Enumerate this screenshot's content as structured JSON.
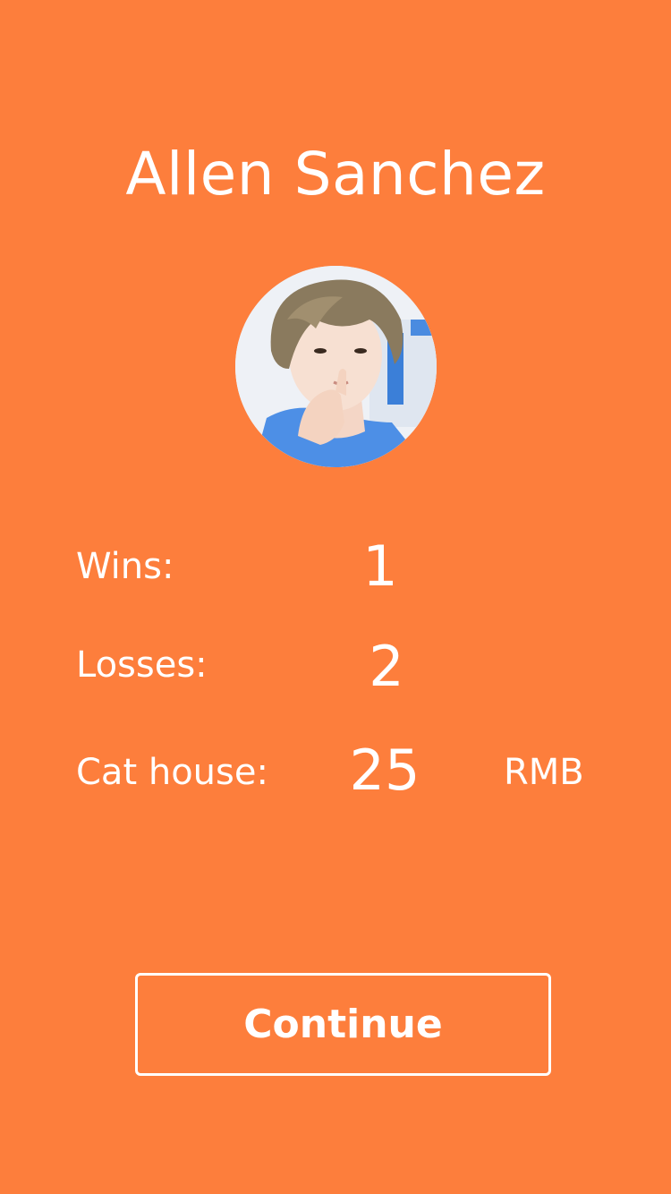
{
  "player": {
    "name": "Allen Sanchez",
    "avatar_icon": "user-avatar-photo"
  },
  "stats": {
    "wins_label": "Wins:",
    "wins_value": "1",
    "losses_label": "Losses:",
    "losses_value": "2",
    "cat_house_label": "Cat house:",
    "cat_house_value": "25",
    "cat_house_unit": "RMB"
  },
  "actions": {
    "continue_label": "Continue"
  },
  "colors": {
    "background": "#fd7e3c",
    "text": "#ffffff"
  }
}
